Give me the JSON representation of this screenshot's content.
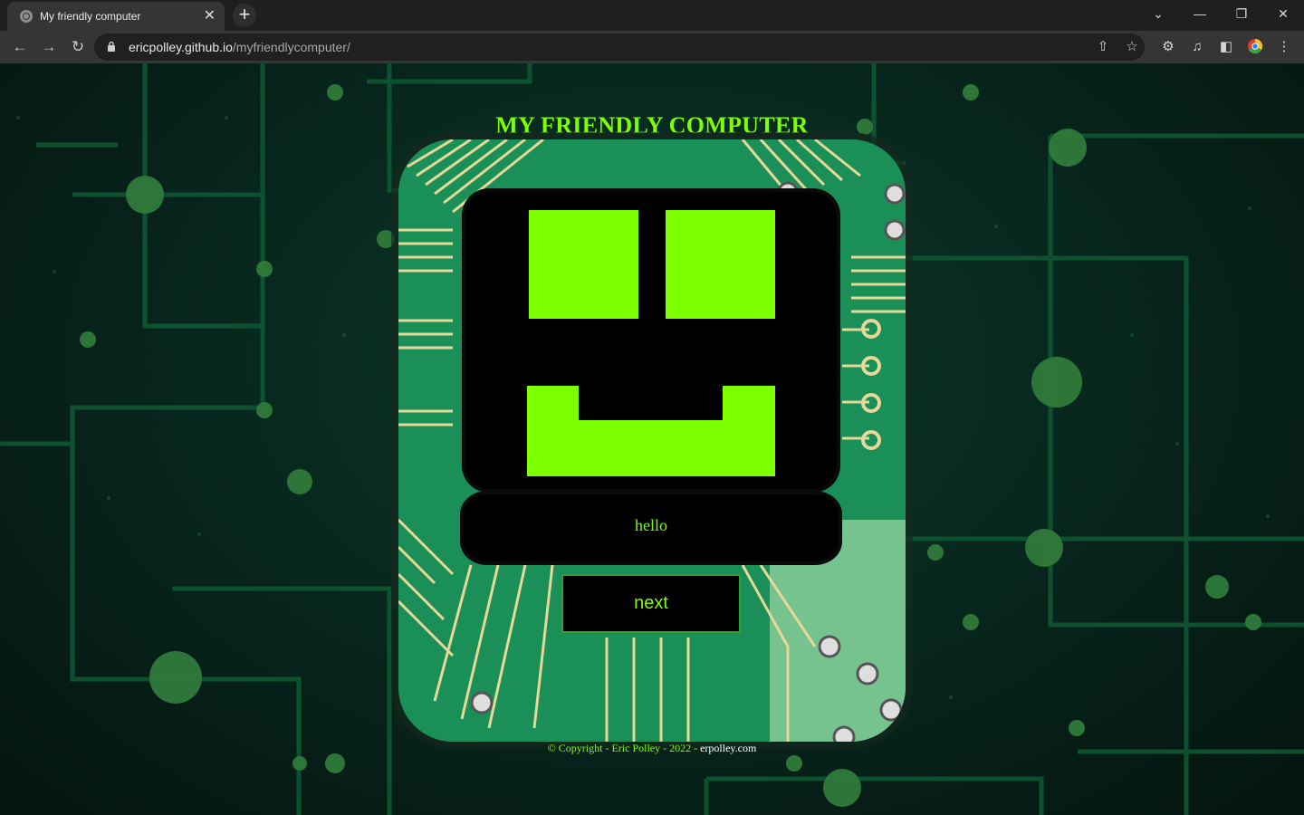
{
  "browser": {
    "tab_title": "My friendly computer",
    "tab_close": "✕",
    "new_tab": "+",
    "url_host": "ericpolley.github.io",
    "url_path": "/myfriendlycomputer/",
    "window_controls": [
      "⌄",
      "—",
      "❐",
      "✕"
    ]
  },
  "page": {
    "title": "MY FRIENDLY COMPUTER",
    "speech": "hello",
    "next_label": "next",
    "footer_copyright": "© Copyright - Eric Polley - 2022 - ",
    "footer_site": "erpolley.com"
  },
  "colors": {
    "accent": "#7cff00",
    "screen": "#000000",
    "board": "#1b8c55"
  },
  "icons": [
    "back-icon",
    "forward-icon",
    "reload-icon",
    "lock-icon",
    "share-icon",
    "star-icon",
    "extensions-icon",
    "media-icon",
    "sidepanel-icon",
    "profile-icon",
    "menu-icon"
  ]
}
